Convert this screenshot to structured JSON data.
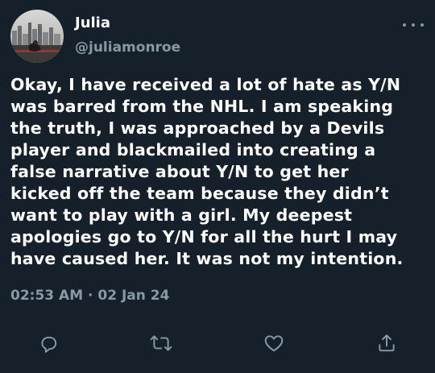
{
  "author": {
    "name": "Julia",
    "handle": "@juliamonroe"
  },
  "tweet": {
    "lines": [
      "Okay, I have received a lot of hate as Y/N",
      "was barred from the NHL. I am speaking",
      "the truth, I was approached by a Devils",
      "player and blackmailed into creating a",
      "false narrative about Y/N to get her",
      "kicked off the team because they didn’t",
      "want to play with a girl. My deepest",
      "apologies go to Y/N for all the hurt I may",
      "have caused her. It was not my intention."
    ],
    "timestamp": "02:53 AM · 02 Jan 24"
  },
  "actions": {
    "reply_icon": "reply-icon",
    "retweet_icon": "retweet-icon",
    "like_icon": "heart-icon",
    "share_icon": "share-icon"
  },
  "colors": {
    "background": "#15202b",
    "text": "#ffffff",
    "secondary": "#8899a6"
  }
}
